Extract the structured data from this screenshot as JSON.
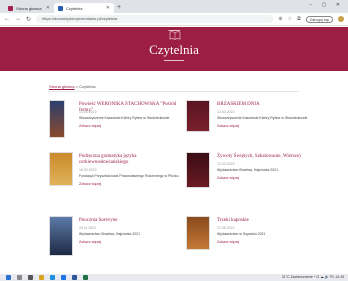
{
  "browser": {
    "tabs": [
      {
        "label": "Strona główna"
      },
      {
        "label": "Czytelnia"
      }
    ],
    "new_tab": "+",
    "window_controls": "– ▢ ✕",
    "url": "https://domowydomprzemianiu.pl/czytelnia",
    "sign_in": "Zaloguj się"
  },
  "site": {
    "title": "Czytelnia",
    "accent": "#9c1e44"
  },
  "breadcrumb": {
    "home": "Strona główna",
    "separator": ">",
    "current": "Czytelnia"
  },
  "articles": [
    {
      "title": "Powieść WERONIKA STACHOWSKA \"Pośród fermy\"",
      "date": "13.03.2022",
      "publisher": "Stowarzyszenie Kaszubski Kiebry Rybne w Studzienkowie",
      "more": "Zobacz więcej"
    },
    {
      "title": "BRZASKIEM DNIA",
      "date": "13.03.2022",
      "publisher": "Stowarzyszenie Kaszubski Kiebry Rybne w Studzienkowie",
      "more": "Zobacz więcej"
    },
    {
      "title": "Podręczna gramatyka języka cerkiewnosłowiańskiego",
      "date": "15.03.2022",
      "publisher": "Fundacja Przyszłościowa Prawosławnego Rodzinnego w Płocku",
      "more": "Zobacz więcej"
    },
    {
      "title": "Żywoty Świętych, Szkalowanie, Wiersze)",
      "date": "12.03.2022",
      "publisher": "Wydawnictwo Bractwa, Hajnówka 2021",
      "more": "Zobacz więcej"
    },
    {
      "title": "Poucznia Sorevyne",
      "date": "09.11.2021",
      "publisher": "Wydawnictwo Bractwa, Hajnówka 2021",
      "more": "Zobacz więcej"
    },
    {
      "title": "Trzeki kaposkie",
      "date": "27.08.2021",
      "publisher": "Wydawnictwo w Supraślu 2021",
      "more": "Zobacz więcej"
    }
  ],
  "taskbar": {
    "tray_text": "21°C  Zachmurzenie  ^ ⊡ ☁ 🔊 PL  14:15"
  }
}
